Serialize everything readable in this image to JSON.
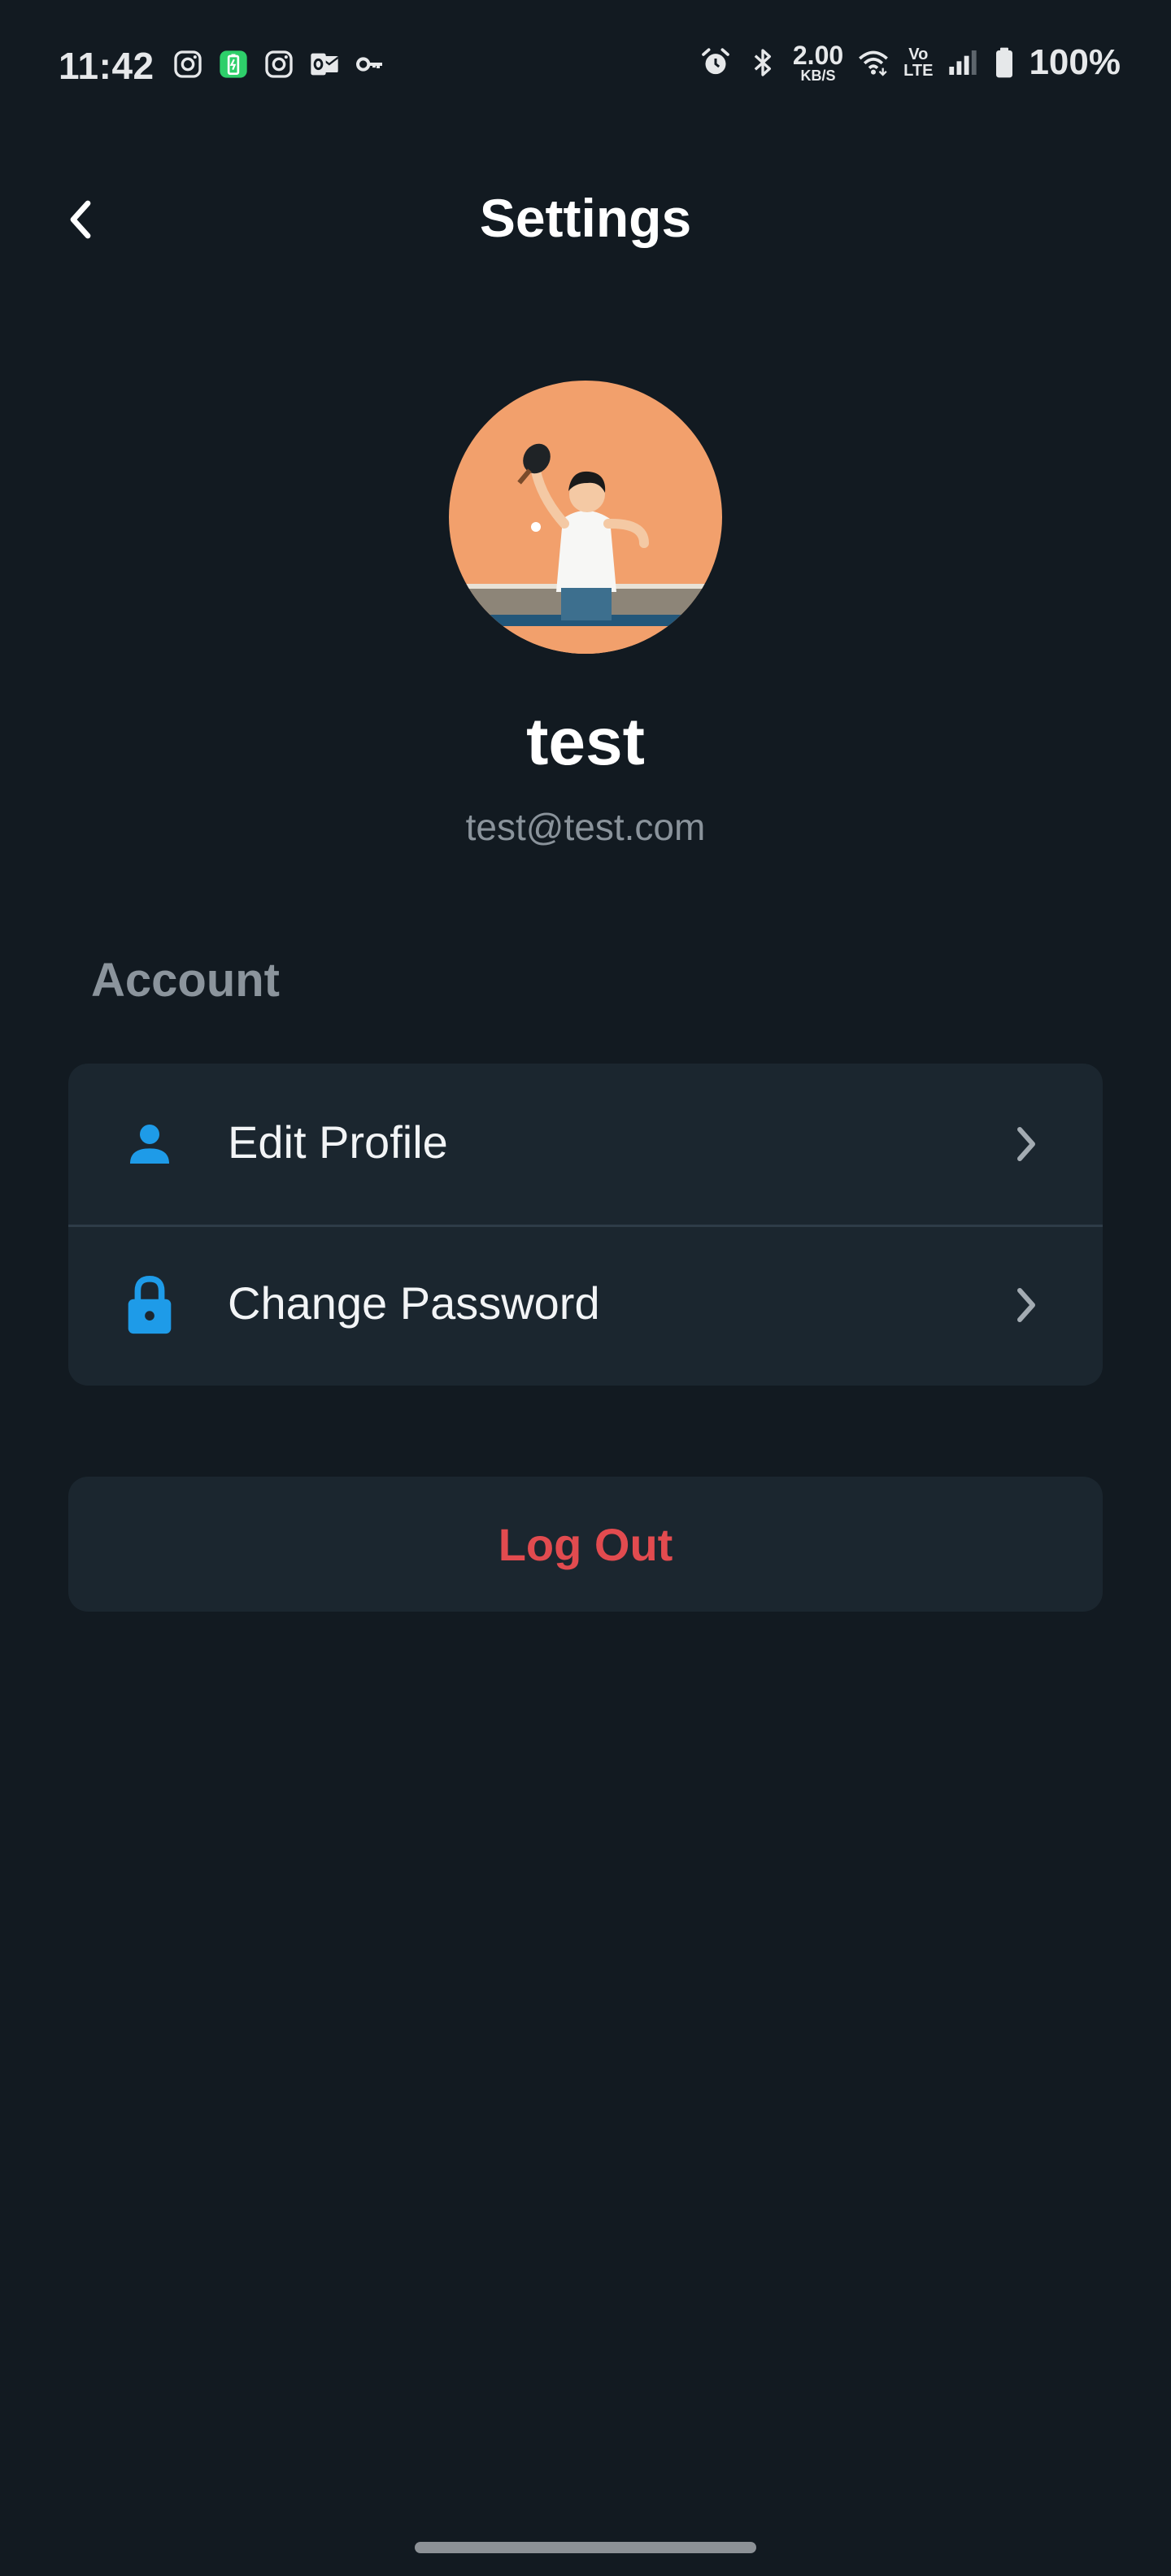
{
  "status_bar": {
    "time": "11:42",
    "net_rate_value": "2.00",
    "net_rate_unit": "KB/S",
    "volte_top": "Vo",
    "volte_bottom": "LTE",
    "battery": "100%",
    "left_icons": [
      "instagram-icon",
      "battery-saver-icon",
      "instagram-icon",
      "outlook-icon",
      "key-icon"
    ],
    "right_icons": [
      "alarm-icon",
      "bluetooth-icon",
      "wifi-icon",
      "signal-icon",
      "battery-icon"
    ]
  },
  "header": {
    "title": "Settings",
    "back_icon": "chevron-left-icon"
  },
  "profile": {
    "name": "test",
    "email": "test@test.com"
  },
  "account": {
    "section_label": "Account",
    "items": [
      {
        "label": "Edit Profile",
        "icon": "person-icon"
      },
      {
        "label": "Change Password",
        "icon": "lock-icon"
      }
    ]
  },
  "logout": {
    "label": "Log Out"
  },
  "colors": {
    "background": "#121a21",
    "card": "#1b262f",
    "accent": "#1e9be8",
    "danger": "#e24b4f",
    "muted_text": "#8b949c"
  }
}
